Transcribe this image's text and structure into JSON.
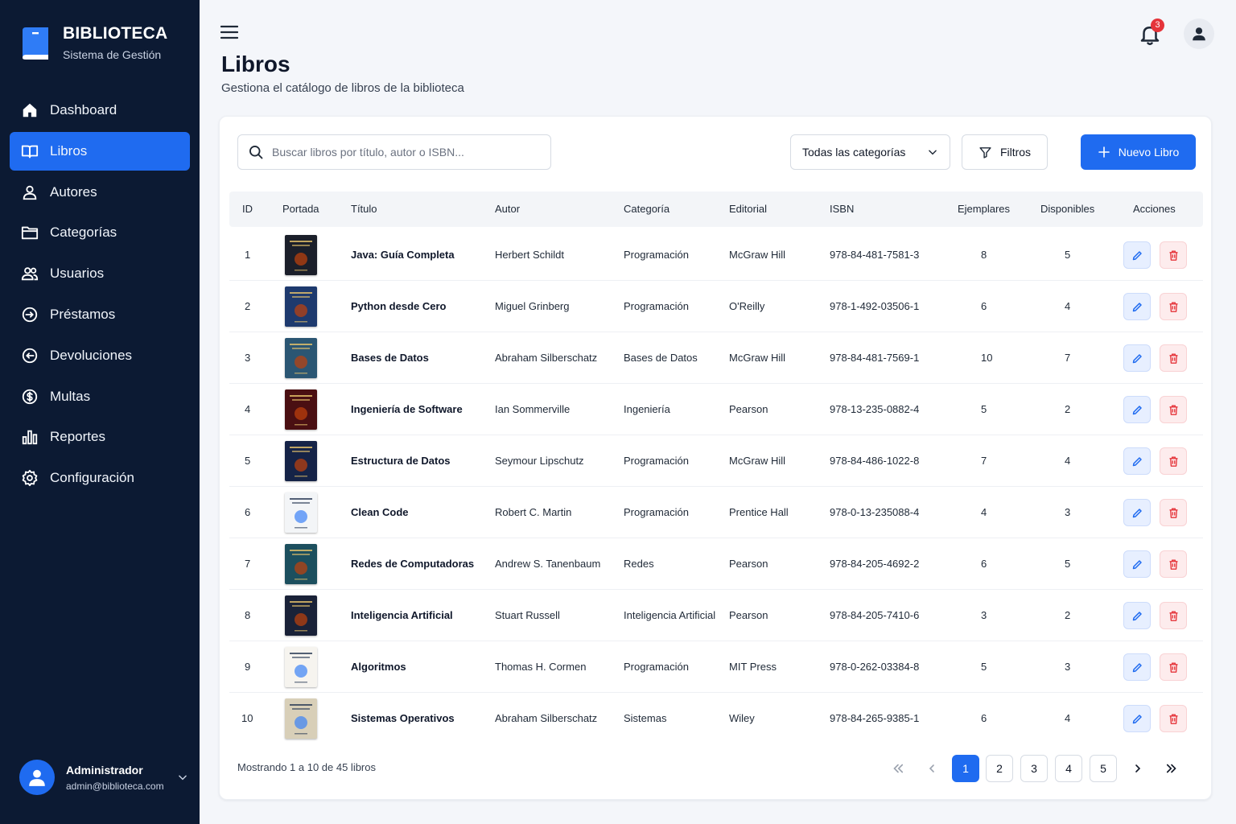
{
  "brand": {
    "title": "BIBLIOTECA",
    "subtitle": "Sistema de Gestión"
  },
  "sidebar": {
    "items": [
      {
        "label": "Dashboard",
        "icon": "home-icon"
      },
      {
        "label": "Libros",
        "icon": "book-open-icon",
        "active": true
      },
      {
        "label": "Autores",
        "icon": "user-icon"
      },
      {
        "label": "Categorías",
        "icon": "folder-icon"
      },
      {
        "label": "Usuarios",
        "icon": "users-icon"
      },
      {
        "label": "Préstamos",
        "icon": "arrow-right-circle-icon"
      },
      {
        "label": "Devoluciones",
        "icon": "arrow-left-circle-icon"
      },
      {
        "label": "Multas",
        "icon": "dollar-circle-icon"
      },
      {
        "label": "Reportes",
        "icon": "bar-chart-icon"
      },
      {
        "label": "Configuración",
        "icon": "gear-icon"
      }
    ]
  },
  "user": {
    "name": "Administrador",
    "email": "admin@biblioteca.com"
  },
  "header": {
    "title": "Libros",
    "subtitle": "Gestiona el catálogo de libros de la biblioteca",
    "notifications": "3"
  },
  "toolbar": {
    "search_placeholder": "Buscar libros por título, autor o ISBN...",
    "category_selected": "Todas las categorías",
    "filters_label": "Filtros",
    "new_label": "Nuevo Libro"
  },
  "table": {
    "columns": [
      "ID",
      "Portada",
      "Título",
      "Autor",
      "Categoría",
      "Editorial",
      "ISBN",
      "Ejemplares",
      "Disponibles",
      "Acciones"
    ],
    "rows": [
      {
        "id": "1",
        "title": "Java: Guía Completa",
        "author": "Herbert Schildt",
        "category": "Programación",
        "publisher": "McGraw Hill",
        "isbn": "978-84-481-7581-3",
        "copies": "8",
        "available": "5",
        "cover": "#1b1f2a"
      },
      {
        "id": "2",
        "title": "Python desde Cero",
        "author": "Miguel Grinberg",
        "category": "Programación",
        "publisher": "O'Reilly",
        "isbn": "978-1-492-03506-1",
        "copies": "6",
        "available": "4",
        "cover": "#1e3a6e"
      },
      {
        "id": "3",
        "title": "Bases de Datos",
        "author": "Abraham Silberschatz",
        "category": "Bases de Datos",
        "publisher": "McGraw Hill",
        "isbn": "978-84-481-7569-1",
        "copies": "10",
        "available": "7",
        "cover": "#2b5673"
      },
      {
        "id": "4",
        "title": "Ingeniería de Software",
        "author": "Ian Sommerville",
        "category": "Ingeniería",
        "publisher": "Pearson",
        "isbn": "978-13-235-0882-4",
        "copies": "5",
        "available": "2",
        "cover": "#4a0f12"
      },
      {
        "id": "5",
        "title": "Estructura de Datos",
        "author": "Seymour Lipschutz",
        "category": "Programación",
        "publisher": "McGraw Hill",
        "isbn": "978-84-486-1022-8",
        "copies": "7",
        "available": "4",
        "cover": "#152347"
      },
      {
        "id": "6",
        "title": "Clean Code",
        "author": "Robert C. Martin",
        "category": "Programación",
        "publisher": "Prentice Hall",
        "isbn": "978-0-13-235088-4",
        "copies": "4",
        "available": "3",
        "cover": "#f3f5f7"
      },
      {
        "id": "7",
        "title": "Redes de Computadoras",
        "author": "Andrew S. Tanenbaum",
        "category": "Redes",
        "publisher": "Pearson",
        "isbn": "978-84-205-4692-2",
        "copies": "6",
        "available": "5",
        "cover": "#1c4f5e"
      },
      {
        "id": "8",
        "title": "Inteligencia Artificial",
        "author": "Stuart Russell",
        "category": "Inteligencia Artificial",
        "publisher": "Pearson",
        "isbn": "978-84-205-7410-6",
        "copies": "3",
        "available": "2",
        "cover": "#1a2238"
      },
      {
        "id": "9",
        "title": "Algoritmos",
        "author": "Thomas H. Cormen",
        "category": "Programación",
        "publisher": "MIT Press",
        "isbn": "978-0-262-03384-8",
        "copies": "5",
        "available": "3",
        "cover": "#f6f4ef"
      },
      {
        "id": "10",
        "title": "Sistemas Operativos",
        "author": "Abraham Silberschatz",
        "category": "Sistemas",
        "publisher": "Wiley",
        "isbn": "978-84-265-9385-1",
        "copies": "6",
        "available": "4",
        "cover": "#d8cfb8"
      }
    ]
  },
  "pagination": {
    "summary": "Mostrando 1 a 10 de 45 libros",
    "pages": [
      "1",
      "2",
      "3",
      "4",
      "5"
    ],
    "current": "1"
  },
  "colors": {
    "sidebar": "#0c1a33",
    "accent": "#1f6bf0",
    "danger": "#e5343a"
  }
}
